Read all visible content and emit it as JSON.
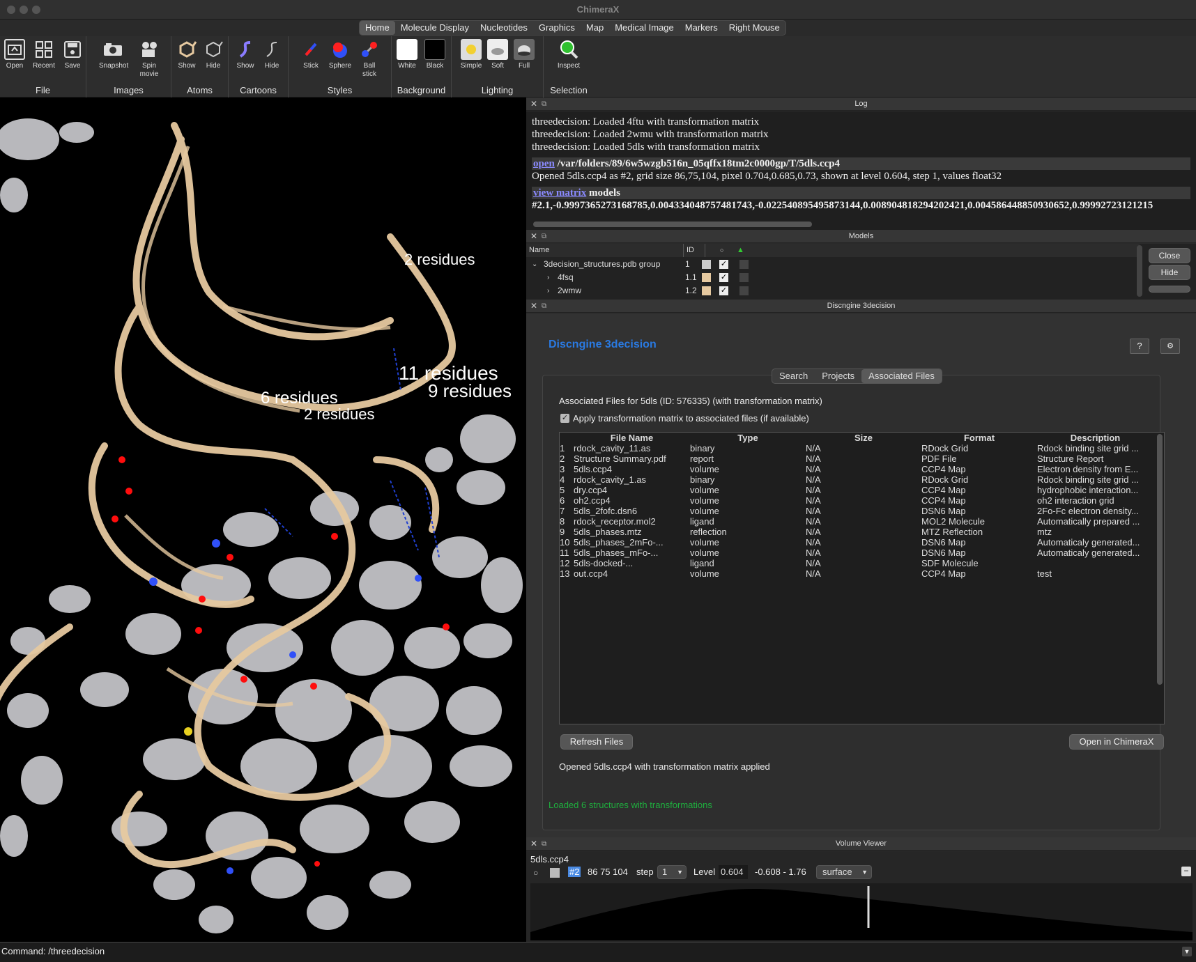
{
  "app": {
    "title": "ChimeraX"
  },
  "tabs": [
    "Home",
    "Molecule Display",
    "Nucleotides",
    "Graphics",
    "Map",
    "Medical Image",
    "Markers",
    "Right Mouse"
  ],
  "ribbon": {
    "groups": {
      "file": "File",
      "images": "Images",
      "atoms": "Atoms",
      "cartoons": "Cartoons",
      "styles": "Styles",
      "background": "Background",
      "lighting": "Lighting",
      "selection": "Selection"
    },
    "buttons": {
      "open": "Open",
      "recent": "Recent",
      "save": "Save",
      "snapshot": "Snapshot",
      "spin1": "Spin",
      "spin2": "movie",
      "atoms_show": "Show",
      "atoms_hide": "Hide",
      "cart_show": "Show",
      "cart_hide": "Hide",
      "stick": "Stick",
      "sphere": "Sphere",
      "ball1": "Ball",
      "ball2": "stick",
      "white": "White",
      "black": "Black",
      "simple": "Simple",
      "soft": "Soft",
      "full": "Full",
      "inspect": "Inspect"
    }
  },
  "viewer": {
    "labels": [
      "2 residues",
      "11 residues",
      "9 residues",
      "6 residues",
      "2 residues"
    ],
    "colors": {
      "ribbon": "#e6c9a0",
      "density": "#c8c8cc",
      "oxygen": "#ff0d0d",
      "nitrogen": "#3050f8"
    }
  },
  "log": {
    "header": "Log",
    "lines": [
      "threedecision: Loaded 4ftu with transformation matrix",
      "threedecision: Loaded 2wmu with transformation matrix",
      "threedecision: Loaded 5dls with transformation matrix"
    ],
    "open_cmd": "open",
    "open_path": " /var/folders/89/6w5wzgb516n_05qffx18tm2c0000gp/T/5dls.ccp4",
    "opened_line": "Opened 5dls.ccp4 as #2, grid size 86,75,104, pixel 0.704,0.685,0.73, shown at level 0.604, step 1, values float32",
    "view_cmd": "view matrix",
    "view_rest": " models",
    "matrix_line": "#2.1,-0.9997365273168785,0.004334048757481743,-0.022540895495873144,0.008904818294202421,0.004586448850930652,0.99992723121215"
  },
  "models": {
    "header": "Models",
    "cols": {
      "name": "Name",
      "id": "ID"
    },
    "rows": [
      {
        "name": "3decision_structures.pdb group",
        "id": "1"
      },
      {
        "name": "4fsq",
        "id": "1.1"
      },
      {
        "name": "2wmw",
        "id": "1.2"
      }
    ],
    "close": "Close",
    "hide": "Hide"
  },
  "discngine": {
    "header": "Discngine 3decision",
    "title": "Discngine 3decision",
    "help": "?",
    "settings": "⚙",
    "tabs": [
      "Search",
      "Projects",
      "Associated Files"
    ],
    "assoc_title": "Associated Files for 5dls (ID: 576335) (with transformation matrix)",
    "apply_label": "Apply transformation matrix to associated files (if available)",
    "columns": [
      "File Name",
      "Type",
      "Size",
      "Format",
      "Description"
    ],
    "rows": [
      {
        "n": "1",
        "name": "rdock_cavity_11.as",
        "type": "binary",
        "size": "N/A",
        "format": "RDock Grid",
        "desc": "Rdock binding site grid ..."
      },
      {
        "n": "2",
        "name": "Structure Summary.pdf",
        "type": "report",
        "size": "N/A",
        "format": "PDF File",
        "desc": "Structure Report"
      },
      {
        "n": "3",
        "name": "5dls.ccp4",
        "type": "volume",
        "size": "N/A",
        "format": "CCP4 Map",
        "desc": "Electron density from E..."
      },
      {
        "n": "4",
        "name": "rdock_cavity_1.as",
        "type": "binary",
        "size": "N/A",
        "format": "RDock Grid",
        "desc": "Rdock binding site grid ..."
      },
      {
        "n": "5",
        "name": "dry.ccp4",
        "type": "volume",
        "size": "N/A",
        "format": "CCP4 Map",
        "desc": "hydrophobic interaction..."
      },
      {
        "n": "6",
        "name": "oh2.ccp4",
        "type": "volume",
        "size": "N/A",
        "format": "CCP4 Map",
        "desc": "oh2 interaction grid"
      },
      {
        "n": "7",
        "name": "5dls_2fofc.dsn6",
        "type": "volume",
        "size": "N/A",
        "format": "DSN6 Map",
        "desc": "2Fo-Fc electron density..."
      },
      {
        "n": "8",
        "name": "rdock_receptor.mol2",
        "type": "ligand",
        "size": "N/A",
        "format": "MOL2 Molecule",
        "desc": "Automatically prepared ..."
      },
      {
        "n": "9",
        "name": "5dls_phases.mtz",
        "type": "reflection",
        "size": "N/A",
        "format": "MTZ Reflection",
        "desc": "mtz"
      },
      {
        "n": "10",
        "name": "5dls_phases_2mFo-...",
        "type": "volume",
        "size": "N/A",
        "format": "DSN6 Map",
        "desc": "Automaticaly generated..."
      },
      {
        "n": "11",
        "name": "5dls_phases_mFo-...",
        "type": "volume",
        "size": "N/A",
        "format": "DSN6 Map",
        "desc": "Automaticaly generated..."
      },
      {
        "n": "12",
        "name": "5dls-docked-...",
        "type": "ligand",
        "size": "N/A",
        "format": "SDF Molecule",
        "desc": ""
      },
      {
        "n": "13",
        "name": "out.ccp4",
        "type": "volume",
        "size": "N/A",
        "format": "CCP4 Map",
        "desc": "test"
      }
    ],
    "refresh": "Refresh Files",
    "open_in": "Open in ChimeraX",
    "status": "Opened 5dls.ccp4 with transformation matrix applied",
    "footer": "Loaded 6 structures with transformations",
    "footer_color": "#1fae3e"
  },
  "volume": {
    "header": "Volume Viewer",
    "name": "5dls.ccp4",
    "model": "#2",
    "size": "86 75 104",
    "step_label": "step",
    "step": "1",
    "level_label": "Level",
    "level": "0.604",
    "range": "-0.608 - 1.76",
    "style": "surface"
  },
  "command": {
    "label": "Command:",
    "value": "/threedecision"
  }
}
